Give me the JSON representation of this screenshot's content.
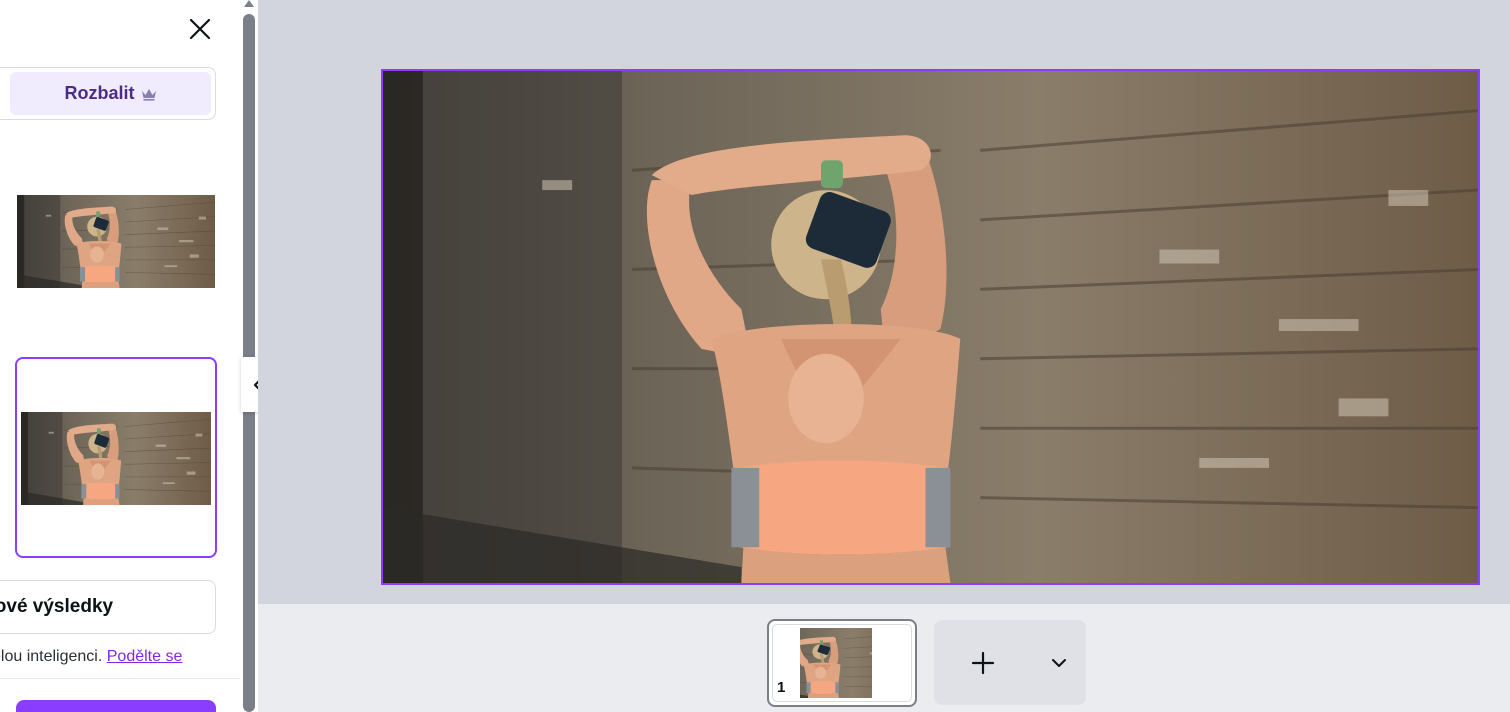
{
  "panel": {
    "toggle_label": "Rozbalit",
    "generate_label": "at nové výsledky",
    "ai_note_text": "élou inteligenci. ",
    "ai_note_link": "Podělte se"
  },
  "pages": {
    "current_number": "1"
  },
  "colors": {
    "accent": "#8b3dff",
    "accent_text": "#4b2d86",
    "workspace_bg": "#d2d5de",
    "link": "#7d2ae8"
  },
  "icons": {
    "close": "close-icon",
    "crown": "crown-icon",
    "collapse": "chevron-left-icon",
    "add": "plus-icon",
    "more": "chevron-down-icon"
  }
}
